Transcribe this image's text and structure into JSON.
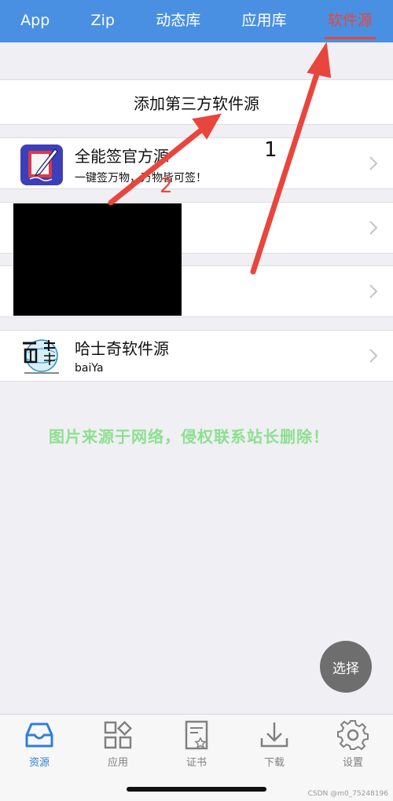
{
  "top_tabs": [
    "App",
    "Zip",
    "动态库",
    "应用库",
    "软件源"
  ],
  "active_tab_index": 4,
  "add_source_label": "添加第三方软件源",
  "sources": [
    {
      "title": "全能签官方源",
      "subtitle": "一键签万物，万物皆可签！",
      "icon": "quill-pen-icon"
    },
    {
      "title": "",
      "subtitle": "",
      "icon": "redacted"
    },
    {
      "title": "",
      "subtitle": "",
      "icon": "redacted"
    },
    {
      "title": "哈士奇软件源",
      "subtitle": "baiYa",
      "icon": "one-stop-logo-icon"
    }
  ],
  "annotations": {
    "label_1": "1",
    "label_2": "2"
  },
  "watermark": "图片来源于网络，侵权联系站长删除！",
  "fab_label": "选择",
  "bottom_nav": [
    {
      "label": "资源",
      "icon": "inbox-tray-icon",
      "active": true
    },
    {
      "label": "应用",
      "icon": "apps-grid-icon",
      "active": false
    },
    {
      "label": "证书",
      "icon": "certificate-icon",
      "active": false
    },
    {
      "label": "下载",
      "icon": "download-icon",
      "active": false
    },
    {
      "label": "设置",
      "icon": "gear-icon",
      "active": false
    }
  ],
  "footer_credit": "CSDN @m0_75248196",
  "colors": {
    "accent": "#4a90e2",
    "active_tab": "#e8463c",
    "arrow": "#e8463c",
    "nav_active": "#2f7fd8"
  }
}
